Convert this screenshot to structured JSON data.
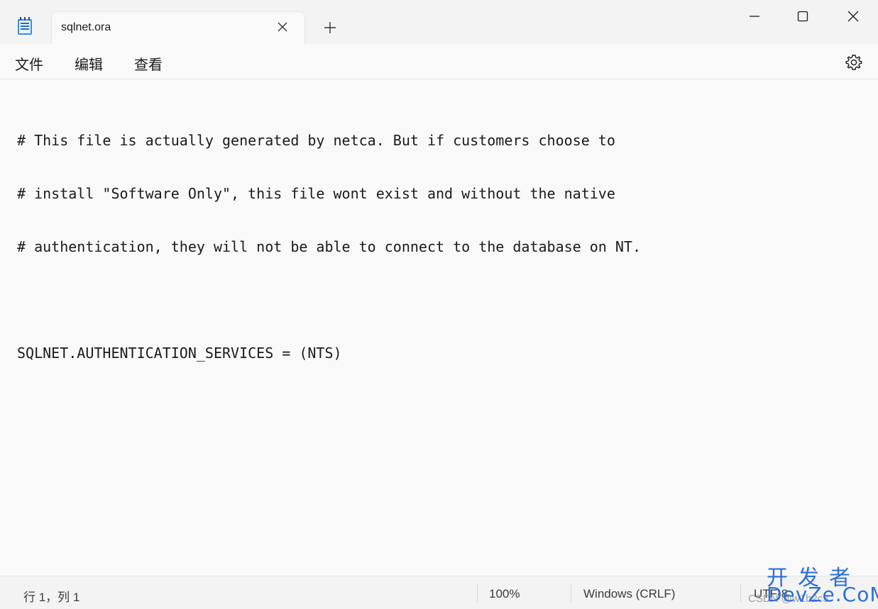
{
  "titlebar": {
    "tab_title": "sqlnet.ora",
    "app_icon": "notepad-icon",
    "new_tab_icon": "plus-icon",
    "close_tab_icon": "close-icon",
    "window_controls": [
      "minimize-icon",
      "maximize-icon",
      "close-icon"
    ]
  },
  "menu": {
    "file": "文件",
    "edit": "编辑",
    "view": "查看",
    "settings_icon": "gear-icon"
  },
  "editor": {
    "lines": [
      "# This file is actually generated by netca. But if customers choose to",
      "# install \"Software Only\", this file wont exist and without the native",
      "# authentication, they will not be able to connect to the database on NT.",
      "",
      "SQLNET.AUTHENTICATION_SERVICES = (NTS)"
    ]
  },
  "status": {
    "position": "行 1，列 1",
    "zoom": "100%",
    "line_ending": "Windows (CRLF)",
    "encoding": "UTF-8"
  },
  "watermark": {
    "top": "开发者",
    "bottom": "DevZe.CoM",
    "small": "CSDN @w1b2c3"
  },
  "colors": {
    "accent": "#2d6fd6",
    "background": "#f9f9f9",
    "chrome": "#f3f3f3",
    "text": "#1b1b1b"
  }
}
